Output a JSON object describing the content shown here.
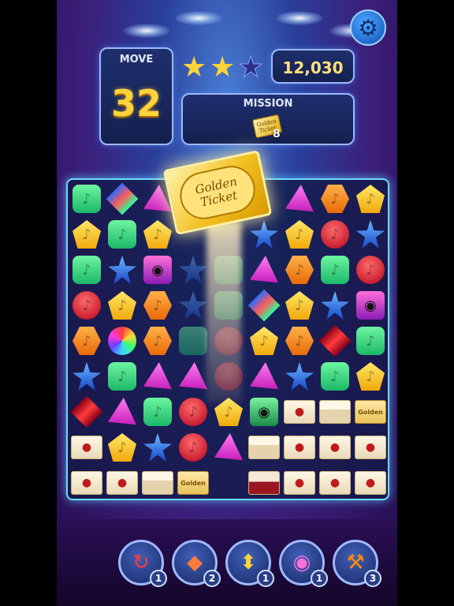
{
  "hud": {
    "moves_label": "MOVE",
    "moves_value": "32",
    "score": "12,030",
    "stars_earned": 2,
    "stars_total": 3,
    "mission_label": "MISSION",
    "mission_item_text": "Golden Ticket",
    "mission_remaining": "8"
  },
  "popup_ticket": {
    "text": "Golden Ticket"
  },
  "icons": {
    "settings": "gear-icon"
  },
  "board": {
    "rows": 9,
    "cols": 9,
    "cells": [
      [
        "green",
        "diamond",
        "pink",
        "ticket",
        "ticket",
        "ticket",
        "pink",
        "orange",
        "yellow"
      ],
      [
        "yellow",
        "green",
        "yellow",
        "ticket",
        "ticket",
        "blue",
        "yellow",
        "red",
        "blue"
      ],
      [
        "green",
        "blue",
        "speaker",
        "blue-ghost",
        "green-ghost",
        "pink",
        "orange",
        "green",
        "red"
      ],
      [
        "red",
        "yellow",
        "orange",
        "blue-ghost",
        "green-ghost",
        "diamond",
        "yellow",
        "blue",
        "speaker"
      ],
      [
        "orange",
        "disco",
        "orange",
        "green-ghost",
        "red-ghost",
        "yellow",
        "orange",
        "diamond-red",
        "green"
      ],
      [
        "blue",
        "green",
        "pink",
        "pink",
        "red-ghost",
        "pink",
        "blue",
        "green",
        "yellow"
      ],
      [
        "diamond-red",
        "pink",
        "green",
        "red",
        "yellow",
        "speaker-green",
        "env",
        "env-open",
        "env-gold"
      ],
      [
        "env",
        "yellow",
        "blue",
        "red",
        "pink",
        "env-open",
        "env",
        "env",
        "env"
      ],
      [
        "env",
        "env",
        "env-open",
        "env-gold",
        "empty",
        "env-red",
        "env",
        "env",
        "env"
      ]
    ],
    "env_gold_text": "Golden"
  },
  "boosters": [
    {
      "icon": "shuffle-icon",
      "count": "1"
    },
    {
      "icon": "rainbow-diamond-icon",
      "count": "2"
    },
    {
      "icon": "rainbow-arrow-icon",
      "count": "1"
    },
    {
      "icon": "speaker-icon",
      "count": "1"
    },
    {
      "icon": "hammer-icon",
      "count": "3"
    }
  ],
  "colors": {
    "accent": "#ffd43a",
    "panel_border": "#9db7ff",
    "board_border": "#6fd8ff"
  }
}
